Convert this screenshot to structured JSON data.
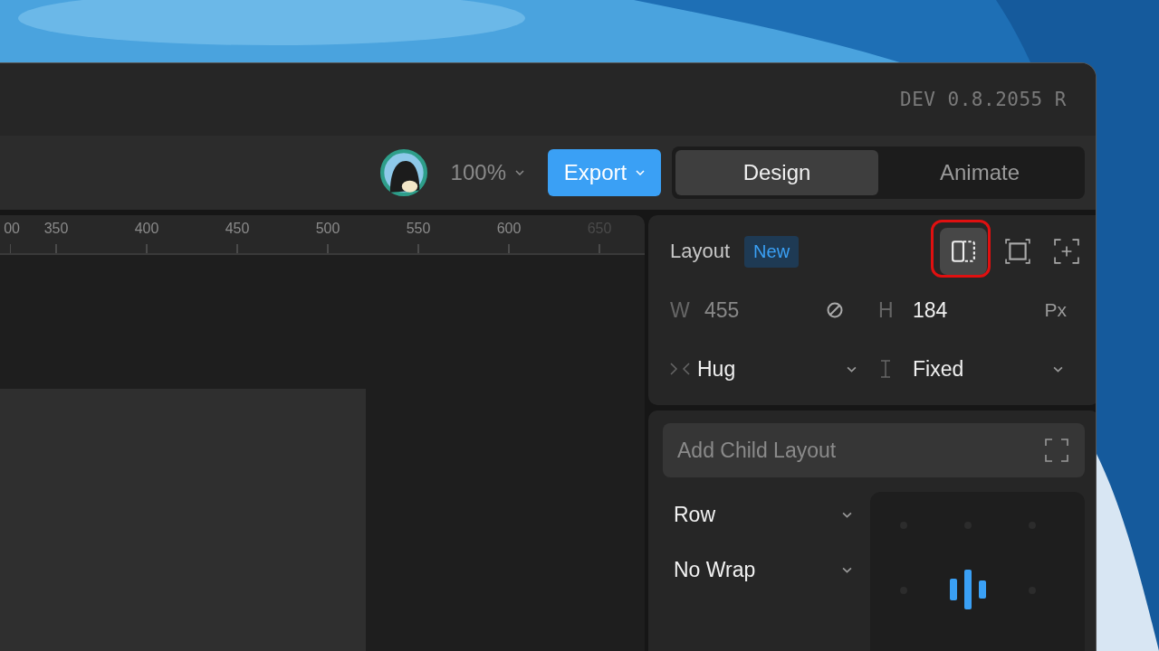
{
  "window": {
    "version": "DEV 0.8.2055 R"
  },
  "toolbar": {
    "zoom": "100%",
    "export_button": "Export",
    "mode_tabs": [
      {
        "label": "Design",
        "selected": true
      },
      {
        "label": "Animate",
        "selected": false
      }
    ]
  },
  "ruler": {
    "labels": [
      {
        "label": "00",
        "faded": false
      },
      {
        "label": "350",
        "faded": false
      },
      {
        "label": "400",
        "faded": false
      },
      {
        "label": "450",
        "faded": false
      },
      {
        "label": "500",
        "faded": false
      },
      {
        "label": "550",
        "faded": false
      },
      {
        "label": "600",
        "faded": false
      },
      {
        "label": "650",
        "faded": true
      }
    ]
  },
  "layout_panel": {
    "title": "Layout",
    "badge": "New",
    "layout_modes": [
      {
        "kind": "split",
        "selected": true,
        "highlighted": true
      },
      {
        "kind": "frame",
        "selected": false,
        "highlighted": false
      },
      {
        "kind": "add",
        "selected": false,
        "highlighted": false
      }
    ],
    "width": {
      "label": "W",
      "value": "455",
      "disabled": true
    },
    "height": {
      "label": "H",
      "value": "184",
      "disabled": false
    },
    "unit": "Px",
    "width_sizing": "Hug",
    "height_sizing": "Fixed"
  },
  "child_layout": {
    "button": "Add Child Layout",
    "direction": "Row",
    "wrap": "No Wrap"
  }
}
